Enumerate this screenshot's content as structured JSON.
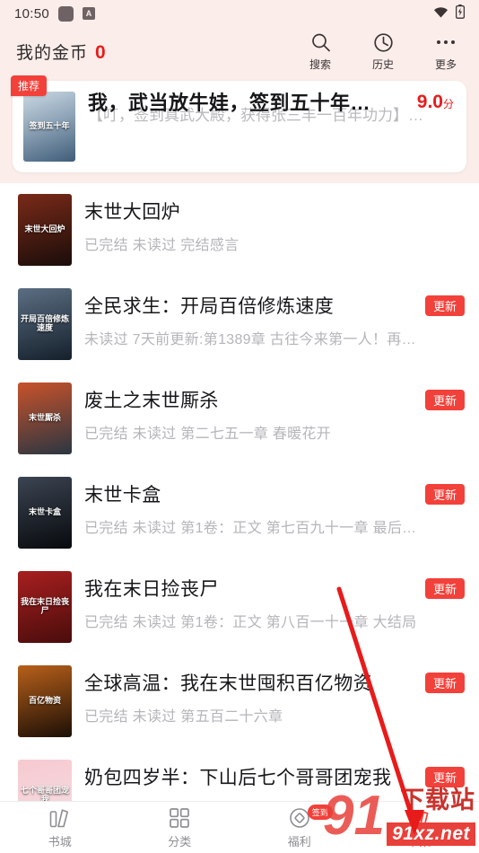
{
  "status_bar": {
    "time": "10:50",
    "icon_square": "rounded-square-icon",
    "icon_letter": "A",
    "wifi_icon": "wifi-icon",
    "battery_icon": "battery-charging-icon"
  },
  "header": {
    "coins_label": "我的金币",
    "coins_value": "0",
    "accent_color": "#e81b1b",
    "actions": [
      {
        "label": "搜索",
        "icon": "search-icon"
      },
      {
        "label": "历史",
        "icon": "history-clock-icon"
      },
      {
        "label": "更多",
        "icon": "more-dots-icon"
      }
    ]
  },
  "feature": {
    "badge": "推荐",
    "badge_color": "#f2413a",
    "title": "我，武当放牛娃，签到五十年…",
    "description": "【叮，签到真武大殿，获得张三丰一百年功力】…",
    "score": "9.0",
    "score_unit": "分",
    "cover_text": "签到五十年"
  },
  "list": {
    "update_tag": "更新",
    "update_tag_color": "#f2413a",
    "items": [
      {
        "title": "末世大回炉",
        "subtitle": "已完结 未读过 完结感言",
        "tag": "",
        "cover_text": "末世大回炉",
        "cover_a": "#7a2a18",
        "cover_b": "#1a0d0a"
      },
      {
        "title": "全民求生：开局百倍修炼速度",
        "subtitle": "未读过 7天前更新:第1389章 古往今来第一人！再…",
        "tag": "更新",
        "cover_text": "开局百倍修炼速度",
        "cover_a": "#5b6e82",
        "cover_b": "#15202b"
      },
      {
        "title": "废土之末世厮杀",
        "subtitle": "已完结 未读过 第二七五一章 春暖花开",
        "tag": "更新",
        "cover_text": "末世厮杀",
        "cover_a": "#c9522a",
        "cover_b": "#2a3642"
      },
      {
        "title": "末世卡盒",
        "subtitle": "已完结 未读过 第1卷：正文 第七百九十一章 最后…",
        "tag": "更新",
        "cover_text": "末世卡盒",
        "cover_a": "#3b4452",
        "cover_b": "#080a0d"
      },
      {
        "title": "我在末日捡丧尸",
        "subtitle": "已完结 未读过 第1卷：正文 第八百一十一章 大结局",
        "tag": "更新",
        "cover_text": "我在末日捡丧尸",
        "cover_a": "#a81f1f",
        "cover_b": "#4a0c0c"
      },
      {
        "title": "全球高温：我在末世囤积百亿物资",
        "subtitle": "已完结 未读过 第五百二十六章",
        "tag": "更新",
        "cover_text": "百亿物资",
        "cover_a": "#b8601a",
        "cover_b": "#1c0f06"
      },
      {
        "title": "奶包四岁半：下山后七个哥哥团宠我",
        "subtitle": "",
        "tag": "更新",
        "cover_text": "七个哥哥团宠我",
        "cover_a": "#f7c9d0",
        "cover_b": "#f2e0e4"
      }
    ]
  },
  "tabbar": {
    "items": [
      {
        "label": "书城",
        "icon": "bookstore-icon",
        "active": false,
        "badge": ""
      },
      {
        "label": "分类",
        "icon": "grid-category-icon",
        "active": false,
        "badge": ""
      },
      {
        "label": "福利",
        "icon": "welfare-circle-icon",
        "active": false,
        "badge": "签到"
      },
      {
        "label": "书架",
        "icon": "bookshelf-icon",
        "active": true,
        "badge": ""
      }
    ]
  },
  "watermark": {
    "logo": "91",
    "text_top": "下载站",
    "text_bottom": "91xz.net"
  }
}
